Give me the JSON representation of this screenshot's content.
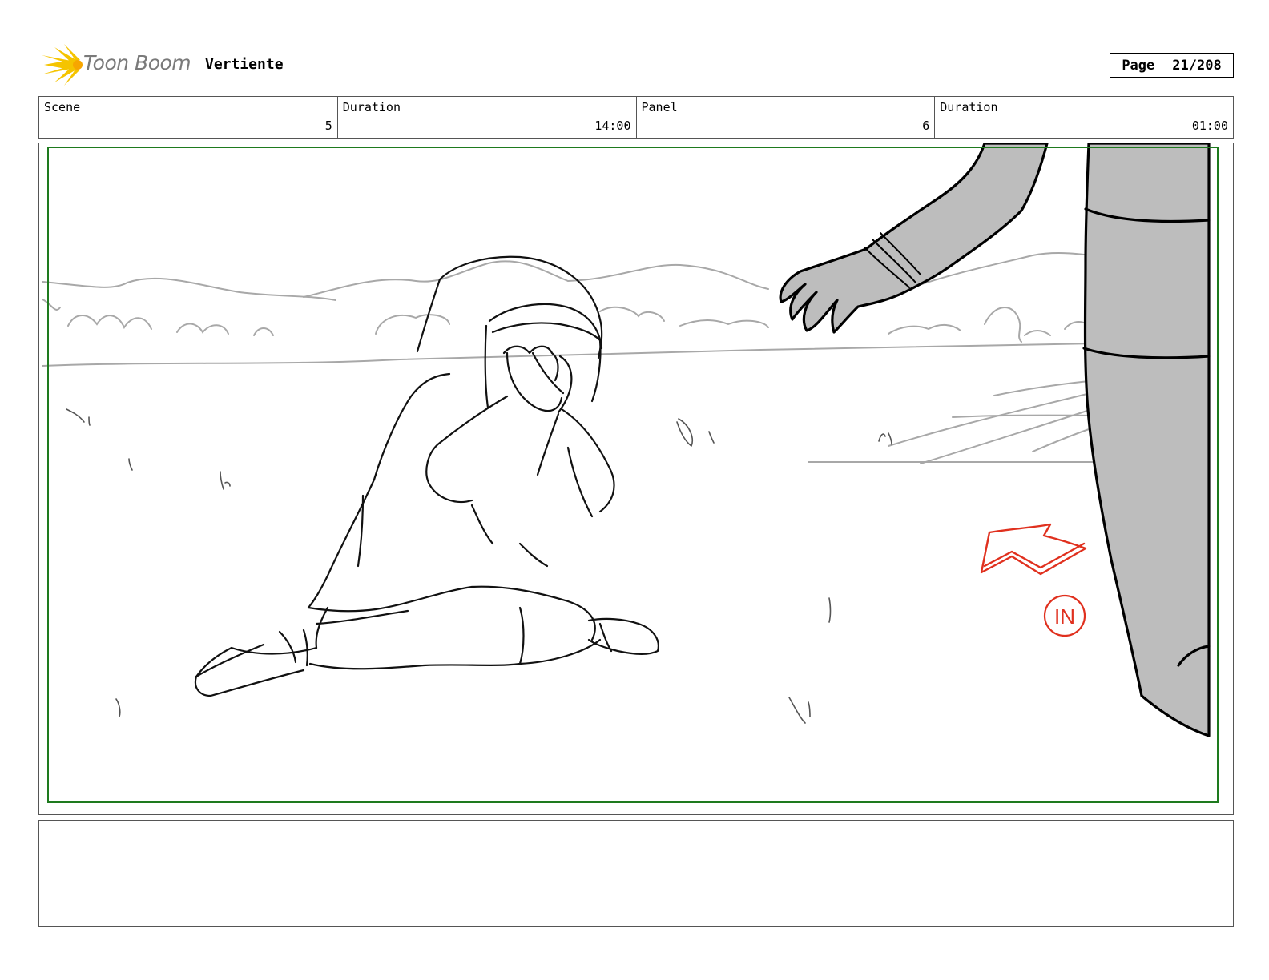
{
  "header": {
    "logo_text": "Toon Boom",
    "project_title": "Vertiente",
    "page_label": "Page",
    "page_number": "21/208"
  },
  "info": {
    "scene_label": "Scene",
    "scene_value": "5",
    "scene_duration_label": "Duration",
    "scene_duration_value": "14:00",
    "panel_label": "Panel",
    "panel_value": "6",
    "panel_duration_label": "Duration",
    "panel_duration_value": "01:00"
  },
  "panel": {
    "annotation_text": "IN",
    "safe_frame_color": "#1e7a1e",
    "annotation_color": "#e0301e",
    "adult_fill_color": "#bdbdbd"
  },
  "notes": {
    "text": ""
  }
}
